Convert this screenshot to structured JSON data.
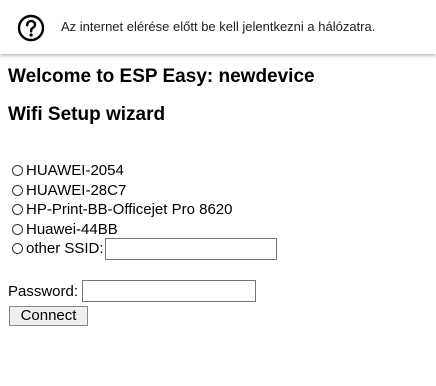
{
  "captive_portal": {
    "icon": "question-circle-icon",
    "message": "Az internet elérése előtt be kell jelentkezni a hálózatra."
  },
  "page": {
    "title": "Welcome to ESP Easy: newdevice",
    "subtitle": "Wifi Setup wizard"
  },
  "ssids": [
    {
      "label": "HUAWEI-2054"
    },
    {
      "label": "HUAWEI-28C7"
    },
    {
      "label": "HP-Print-BB-Officejet Pro 8620"
    },
    {
      "label": "Huawei-44BB"
    }
  ],
  "other_ssid": {
    "label": "other SSID:",
    "value": ""
  },
  "password": {
    "label": "Password:",
    "value": ""
  },
  "connect_button": {
    "label": "Connect"
  }
}
